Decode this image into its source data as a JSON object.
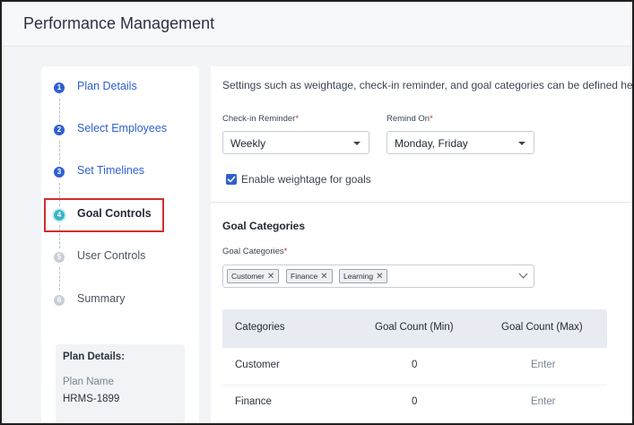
{
  "header": {
    "title": "Performance Management"
  },
  "steps": [
    {
      "num": "1",
      "label": "Plan Details",
      "state": "done"
    },
    {
      "num": "2",
      "label": "Select Employees",
      "state": "done"
    },
    {
      "num": "3",
      "label": "Set Timelines",
      "state": "done"
    },
    {
      "num": "4",
      "label": "Goal Controls",
      "state": "current"
    },
    {
      "num": "5",
      "label": "User Controls",
      "state": "todo"
    },
    {
      "num": "6",
      "label": "Summary",
      "state": "todo"
    }
  ],
  "plan_details": {
    "title": "Plan Details:",
    "plan_name_label": "Plan Name",
    "plan_name_value": "HRMS-1899"
  },
  "main": {
    "intro": "Settings such as weightage, check-in reminder, and goal categories can be defined here.",
    "checkin": {
      "label": "Check-in Reminder",
      "required": "*",
      "value": "Weekly"
    },
    "remind": {
      "label": "Remind On",
      "required": "*",
      "value": "Monday, Friday"
    },
    "weightage": {
      "label": "Enable weightage for goals",
      "checked": true
    },
    "goal_categories": {
      "title": "Goal Categories",
      "field_label": "Goal Categories",
      "required": "*",
      "chips": [
        "Customer",
        "Finance",
        "Learning"
      ]
    },
    "table": {
      "headers": [
        "Categories",
        "Goal Count (Min)",
        "Goal Count (Max)"
      ],
      "rows": [
        {
          "category": "Customer",
          "min": "0",
          "max": "Enter"
        },
        {
          "category": "Finance",
          "min": "0",
          "max": "Enter"
        }
      ]
    }
  },
  "colors": {
    "accent": "#2f5fd0",
    "current": "#3bb3c8",
    "highlight": "#d0302f"
  }
}
